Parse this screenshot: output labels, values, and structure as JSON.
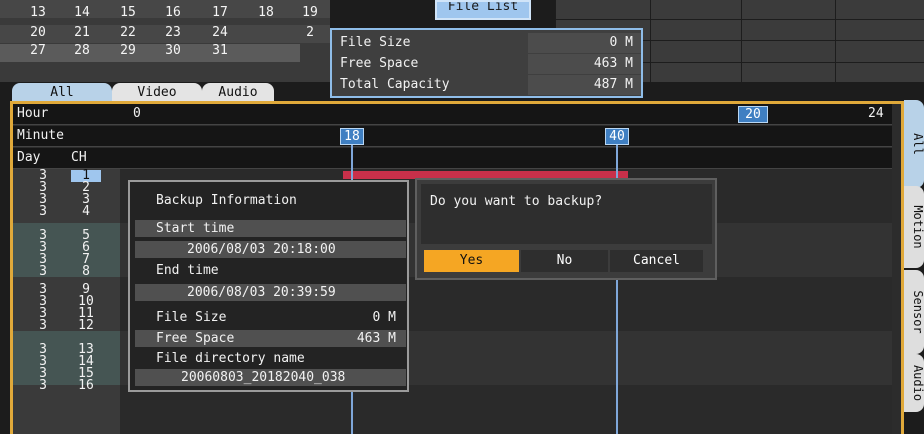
{
  "calendar": {
    "rows": [
      [
        "13",
        "14",
        "15",
        "16",
        "17",
        "18",
        "19"
      ],
      [
        "20",
        "21",
        "22",
        "23",
        "24",
        "2"
      ],
      [
        "27",
        "28",
        "29",
        "30",
        "31"
      ]
    ]
  },
  "file_list_button": "File List",
  "file_info": {
    "file_size_label": "File Size",
    "file_size_value": "0 M",
    "free_space_label": "Free Space",
    "free_space_value": "463 M",
    "total_capacity_label": "Total Capacity",
    "total_capacity_value": "487 M"
  },
  "tabs": {
    "all": "All",
    "video": "Video",
    "audio": "Audio"
  },
  "timeline": {
    "hour_label": "Hour",
    "hour_start": "0",
    "hour_marker": "20",
    "hour_end": "24",
    "minute_label": "Minute",
    "minute_marker_start": "18",
    "minute_marker_end": "40",
    "day_label": "Day",
    "ch_label": "CH",
    "days": [
      "3",
      "3",
      "3",
      "3",
      "3",
      "3",
      "3",
      "3",
      "3",
      "3",
      "3",
      "3",
      "3",
      "3",
      "3",
      "3"
    ],
    "channels": [
      "1",
      "2",
      "3",
      "4",
      "5",
      "6",
      "7",
      "8",
      "9",
      "10",
      "11",
      "12",
      "13",
      "14",
      "15",
      "16"
    ]
  },
  "side_tabs": {
    "all": "All",
    "motion": "Motion",
    "sensor": "Sensor",
    "audio": "Audio"
  },
  "backup_info": {
    "title": "Backup Information",
    "start_label": "Start time",
    "start_value": "2006/08/03   20:18:00",
    "end_label": "End time",
    "end_value": "2006/08/03   20:39:59",
    "file_size_label": "File Size",
    "file_size_value": "0 M",
    "free_space_label": "Free Space",
    "free_space_value": "463 M",
    "dir_label": "File directory name",
    "dir_value": "20060803_20182040_038"
  },
  "dialog": {
    "message": "Do you want to backup?",
    "yes": "Yes",
    "no": "No",
    "cancel": "Cancel"
  },
  "colors": {
    "accent_orange": "#f5a623",
    "marker_blue": "#3f7fc2",
    "record_red": "#c8304a"
  }
}
